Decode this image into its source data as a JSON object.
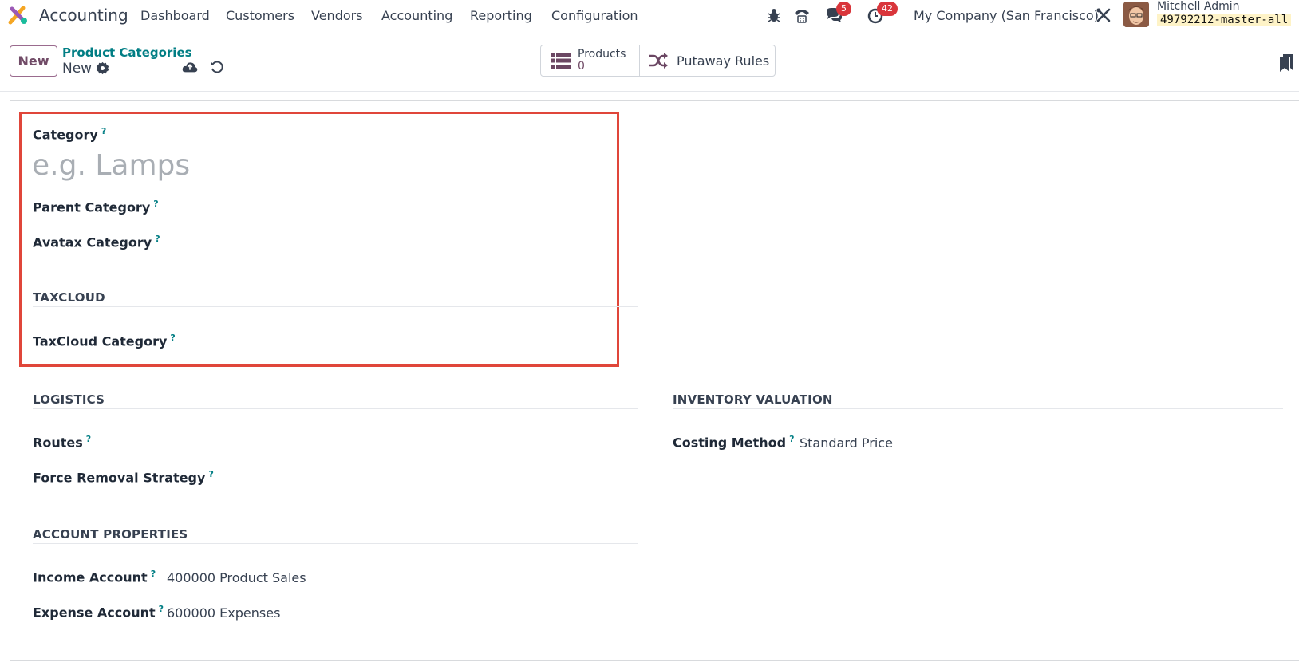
{
  "navbar": {
    "app_name": "Accounting",
    "menu": [
      "Dashboard",
      "Customers",
      "Vendors",
      "Accounting",
      "Reporting",
      "Configuration"
    ],
    "messages_count": "5",
    "activities_count": "42",
    "company": "My Company (San Francisco)",
    "user_name": "Mitchell Admin",
    "database": "49792212-master-all"
  },
  "control_panel": {
    "new_label": "New",
    "breadcrumb_parent": "Product Categories",
    "breadcrumb_current": "New",
    "products_label": "Products",
    "products_count": "0",
    "putaway_label": "Putaway Rules"
  },
  "form": {
    "category_label": "Category",
    "category_placeholder": "e.g. Lamps",
    "parent_category_label": "Parent Category",
    "avatax_category_label": "Avatax Category",
    "taxcloud_section": "TAXCLOUD",
    "taxcloud_category_label": "TaxCloud Category",
    "logistics_section": "LOGISTICS",
    "routes_label": "Routes",
    "force_removal_label": "Force Removal Strategy",
    "inventory_section": "INVENTORY VALUATION",
    "costing_method_label": "Costing Method",
    "costing_method_value": "Standard Price",
    "account_section": "ACCOUNT PROPERTIES",
    "income_account_label": "Income Account",
    "income_account_value": "400000 Product Sales",
    "expense_account_label": "Expense Account",
    "expense_account_value": "600000 Expenses",
    "help_mark": "?"
  },
  "colors": {
    "brand": "#714B67",
    "link": "#017e84",
    "badge": "#d9353b",
    "highlight": "#e0463a"
  }
}
